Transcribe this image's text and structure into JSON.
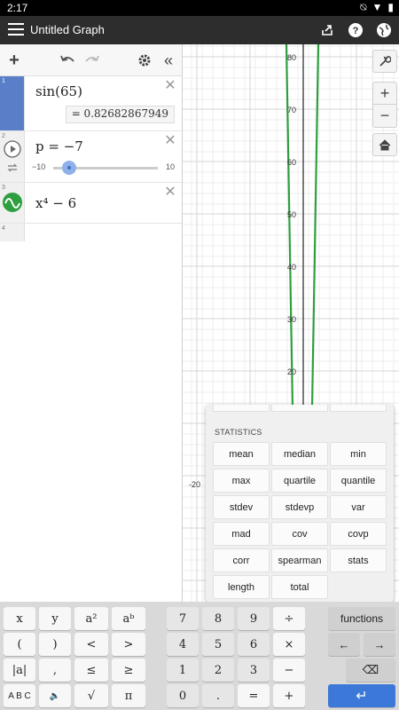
{
  "status": {
    "time": "2:17"
  },
  "app": {
    "title": "Untitled Graph"
  },
  "expressions": [
    {
      "num": "1",
      "text": "sin(65)",
      "result_label": "= 0.82682867949"
    },
    {
      "num": "2",
      "text": "p = −7",
      "slider_min": "−10",
      "slider_max": "10"
    },
    {
      "num": "3",
      "text": "x⁴ − 6"
    },
    {
      "num": "4",
      "text": ""
    }
  ],
  "graph": {
    "y_ticks": [
      "80",
      "70",
      "60",
      "50",
      "40",
      "30",
      "20"
    ],
    "x_tick": "-20"
  },
  "popup": {
    "heading": "STATISTICS",
    "functions": [
      "mean",
      "median",
      "min",
      "max",
      "quartile",
      "quantile",
      "stdev",
      "stdevp",
      "var",
      "mad",
      "cov",
      "covp",
      "corr",
      "spearman",
      "stats",
      "length",
      "total"
    ]
  },
  "keyboard": {
    "row1": [
      "x",
      "y",
      "a²",
      "aᵇ",
      "7",
      "8",
      "9",
      "÷",
      "functions"
    ],
    "row2": [
      "(",
      ")",
      "<",
      ">",
      "4",
      "5",
      "6",
      "×",
      "←",
      "→"
    ],
    "row3": [
      "|a|",
      ",",
      "≤",
      "≥",
      "1",
      "2",
      "3",
      "−",
      "⌫"
    ],
    "row4": [
      "A B C",
      "🔈",
      "√",
      "π",
      "0",
      ".",
      "=",
      "+",
      "↵"
    ]
  },
  "colors": {
    "curve": "#2e9f3e",
    "accent": "#3b78d8",
    "expr1_bar": "#5a7fc8"
  }
}
